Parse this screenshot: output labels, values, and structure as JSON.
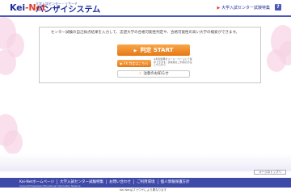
{
  "header": {
    "logo_main": "Kei",
    "logo_accent": "-Net",
    "brand_sub": "大学入試センター・リサーチ",
    "brand_main": "バンザイシステム",
    "link_arrow": "▶",
    "link_label": "大学入試センター試験特集",
    "help_label": "?"
  },
  "panel": {
    "intro": "センター試験の自己採点結果を入力して、志望大学の合格可能性判定や、合格可能性の高い大学の検索ができます。",
    "start_icon": "▶",
    "start_label": "判定 START",
    "small_button_label": "▶ FX 判定はこちら",
    "small_note": "※判定結果をメール・ページにて保存できます。通常版をご利用の方はこちらから",
    "link_label": "注意のお知らせ",
    "warning_icon": "⚠"
  },
  "pagetop_label": "ページのトップへ",
  "footer": {
    "nav": [
      "Kei-Netホームページ",
      "大学入試センター試験特集",
      "お問い合わせ",
      "ご利用環境",
      "個人情報保護方針"
    ],
    "copyright": "Copyright Kawaijuku Educational Information Network",
    "below": "Kei-Netはブラウザにより異なります"
  },
  "colors": {
    "header_border": "#4a57b8",
    "brand": "#1f2f9a",
    "accent_red": "#e23a2a",
    "start_orange": "#e67814",
    "footer_bg": "#3f4aa8"
  }
}
